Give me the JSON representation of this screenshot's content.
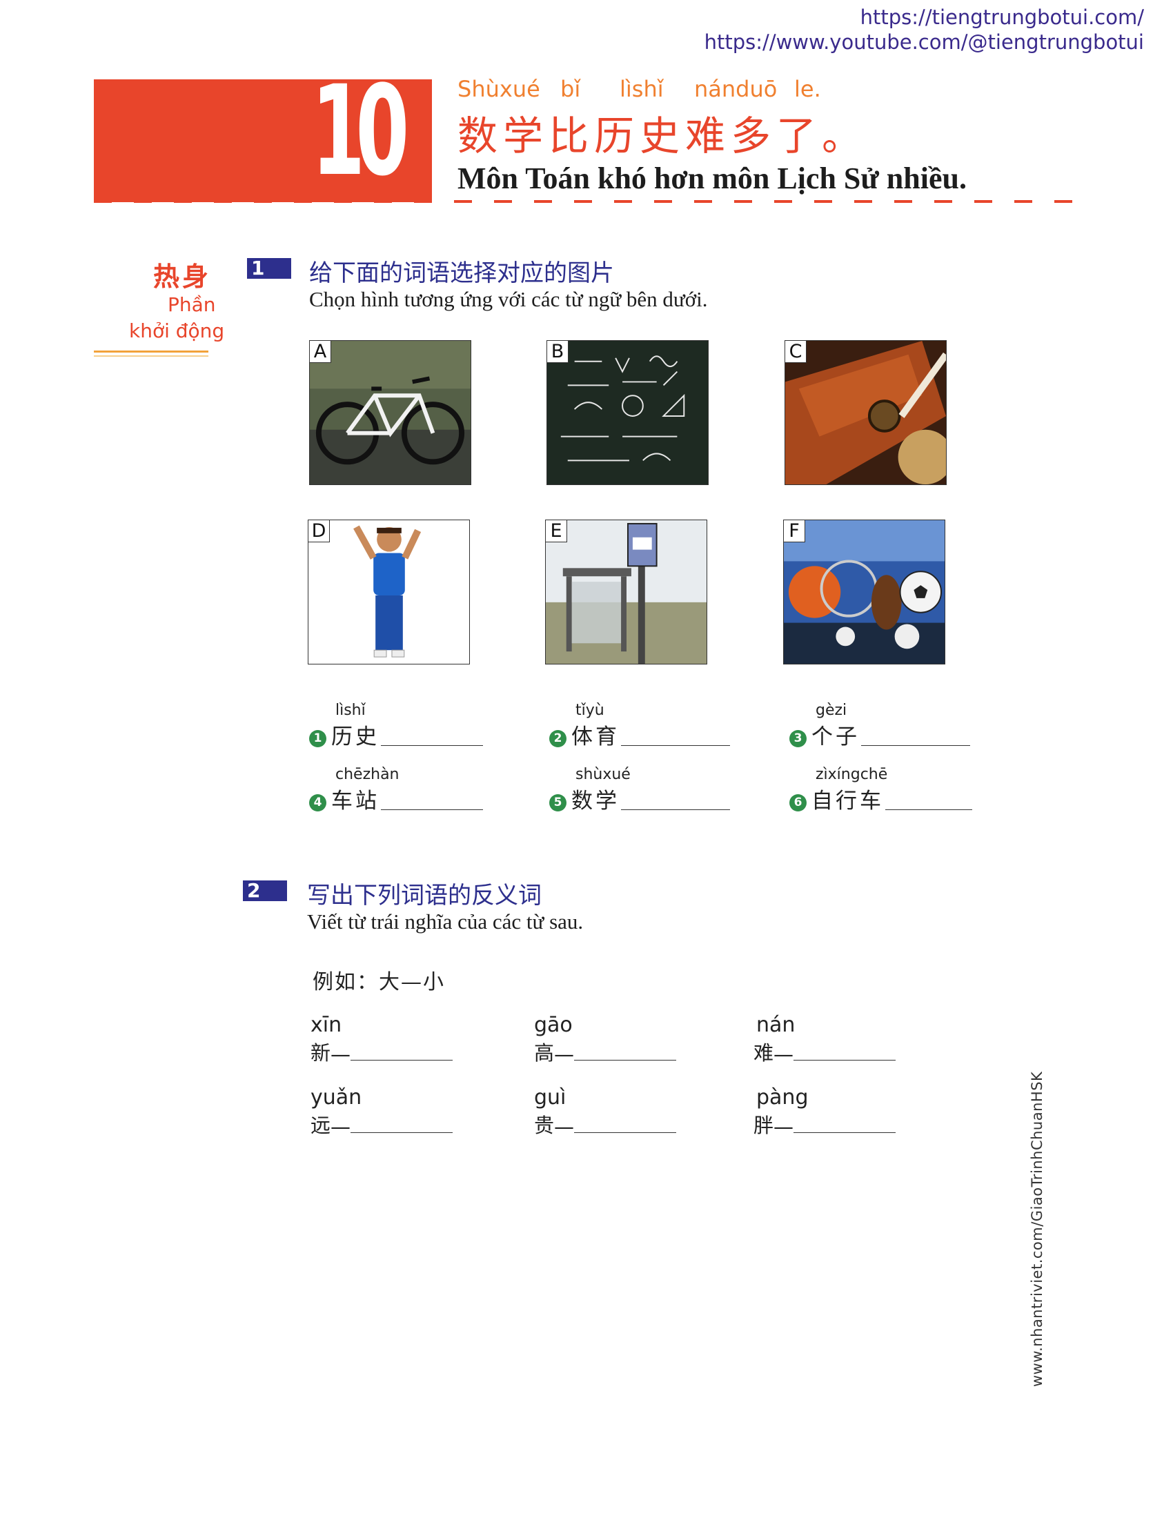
{
  "links": [
    "https://tiengtrungbotui.com/",
    "https://www.youtube.com/@tiengtrungbotui"
  ],
  "header": {
    "lesson_number": "10",
    "pinyin": [
      "Shùxué",
      "bǐ",
      "lìshǐ",
      "nánduō",
      "le."
    ],
    "title_zh": "数学比历史难多了。",
    "title_vi": "Môn Toán khó hơn môn Lịch Sử nhiều."
  },
  "side": {
    "zh": "热身",
    "vi_line1": "Phần",
    "vi_line2": "khởi động"
  },
  "section1": {
    "number": "1",
    "instruction_zh": "给下面的词语选择对应的图片",
    "instruction_vi": "Chọn hình tương ứng với các từ ngữ bên dưới.",
    "pictures": [
      {
        "label": "A",
        "icon": "bicycle-picture"
      },
      {
        "label": "B",
        "icon": "math-blackboard-picture"
      },
      {
        "label": "C",
        "icon": "history-book-picture"
      },
      {
        "label": "D",
        "icon": "child-picture"
      },
      {
        "label": "E",
        "icon": "bus-stop-picture"
      },
      {
        "label": "F",
        "icon": "sports-balls-picture"
      }
    ],
    "words": [
      {
        "num": "1",
        "pinyin": "lìshǐ",
        "hanzi": "历史"
      },
      {
        "num": "2",
        "pinyin": "tǐyù",
        "hanzi": "体育"
      },
      {
        "num": "3",
        "pinyin": "gèzi",
        "hanzi": "个子"
      },
      {
        "num": "4",
        "pinyin": "chēzhàn",
        "hanzi": "车站"
      },
      {
        "num": "5",
        "pinyin": "shùxué",
        "hanzi": "数学"
      },
      {
        "num": "6",
        "pinyin": "zìxíngchē",
        "hanzi": "自行车"
      }
    ]
  },
  "section2": {
    "number": "2",
    "instruction_zh": "写出下列词语的反义词",
    "instruction_vi": "Viết từ trái nghĩa của các từ sau.",
    "example": "例如：大—小",
    "items": [
      {
        "pinyin": "xīn",
        "hanzi": "新"
      },
      {
        "pinyin": "gāo",
        "hanzi": "高"
      },
      {
        "pinyin": "nán",
        "hanzi": "难"
      },
      {
        "pinyin": "yuǎn",
        "hanzi": "远"
      },
      {
        "pinyin": "guì",
        "hanzi": "贵"
      },
      {
        "pinyin": "pàng",
        "hanzi": "胖"
      }
    ],
    "dash": "—"
  },
  "side_url": "www.nhantriviet.com/GiaoTrinhChuanHSK",
  "colors": {
    "accent_red": "#e8452b",
    "accent_orange": "#f08030",
    "section_blue": "#2d2f8d",
    "number_green": "#2f8f4a"
  }
}
